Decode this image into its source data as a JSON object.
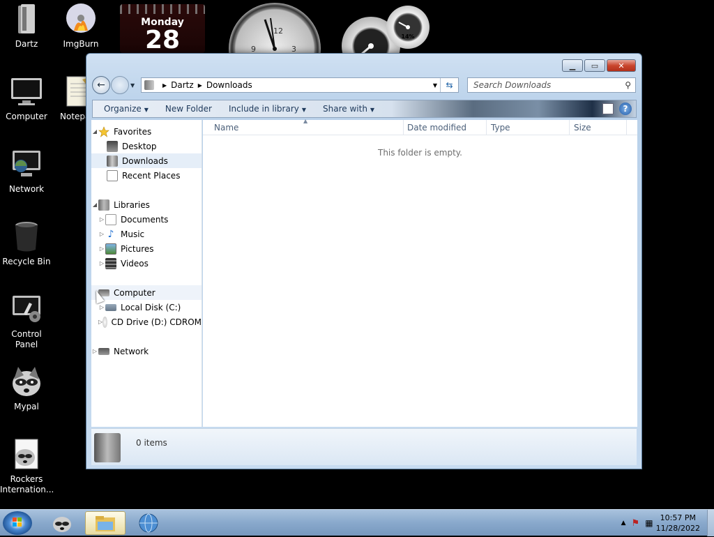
{
  "desktop": {
    "icons": [
      {
        "label": "Dartz"
      },
      {
        "label": "ImgBurn"
      },
      {
        "label": "Computer"
      },
      {
        "label": "Notepa"
      },
      {
        "label": "Network"
      },
      {
        "label": "Recycle Bin"
      },
      {
        "label": "Control Panel"
      },
      {
        "label": "Mypal"
      },
      {
        "label": "Rockers Internation..."
      }
    ]
  },
  "gadgets": {
    "calendar_day": "Monday",
    "calendar_date": "28",
    "cpu_meter_percent": "14%"
  },
  "window": {
    "breadcrumb": [
      "Dartz",
      "Downloads"
    ],
    "search_placeholder": "Search Downloads",
    "toolbar": {
      "organize": "Organize",
      "new_folder": "New Folder",
      "include_in_library": "Include in library",
      "share_with": "Share with"
    },
    "nav": {
      "favorites": "Favorites",
      "desktop": "Desktop",
      "downloads": "Downloads",
      "recent_places": "Recent Places",
      "libraries": "Libraries",
      "documents": "Documents",
      "music": "Music",
      "pictures": "Pictures",
      "videos": "Videos",
      "computer": "Computer",
      "local_disk": "Local Disk (C:)",
      "cd_drive": "CD Drive (D:) CDROM",
      "network": "Network"
    },
    "columns": [
      "Name",
      "Date modified",
      "Type",
      "Size"
    ],
    "empty_message": "This folder is empty.",
    "details_count": "0 items"
  },
  "taskbar": {
    "time": "10:57 PM",
    "date": "11/28/2022"
  },
  "colors": {
    "window_frame": "#b9d1ea",
    "close_button": "#c9462e",
    "taskbar": "#89a9cc"
  }
}
